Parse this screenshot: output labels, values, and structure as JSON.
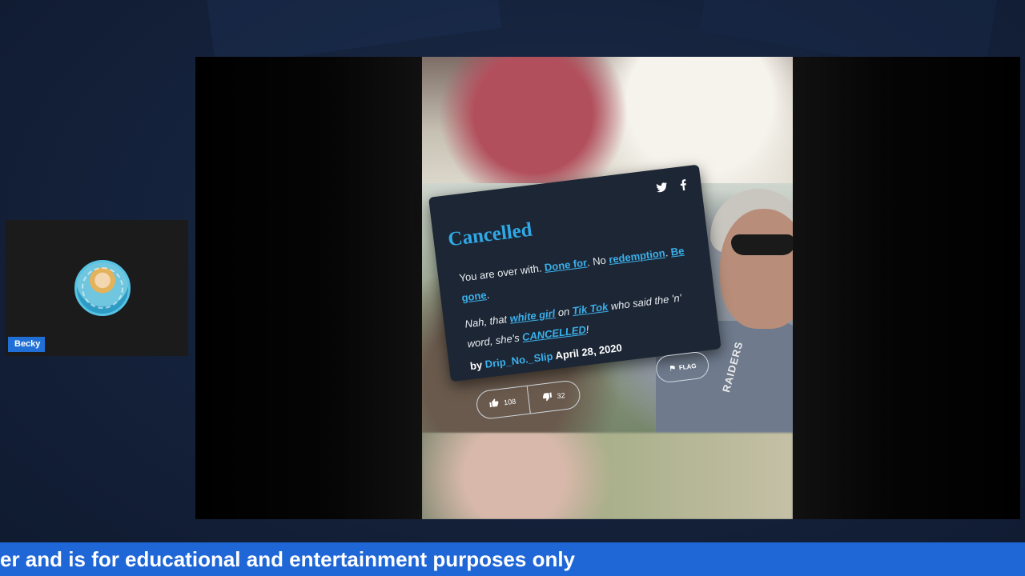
{
  "participant": {
    "name": "Becky"
  },
  "card": {
    "title": "Cancelled",
    "definition": {
      "t1": "You are over with. ",
      "l1": "Done for",
      "t2": ". No ",
      "l2": "redemption",
      "t3": ". ",
      "l3": "Be gone",
      "t4": "."
    },
    "example": {
      "t1": "Nah, that ",
      "l1": "white girl",
      "t2": " on ",
      "l2": "Tik Tok",
      "t3": " who said the 'n' word, she's ",
      "l3": "CANCELLED",
      "t4": "!"
    },
    "author_prefix": "by ",
    "author": "Drip_No._Slip",
    "date": "April 28, 2020",
    "upvotes": "108",
    "downvotes": "32",
    "flag_label": "FLAG"
  },
  "video": {
    "lanyard_text": "RAIDERS"
  },
  "ticker": {
    "text": "er and is for educational and entertainment purposes only"
  },
  "icons": [
    "twitter-icon",
    "facebook-icon",
    "thumbs-up-icon",
    "thumbs-down-icon",
    "flag-icon"
  ],
  "colors": {
    "ticker_bg": "#1f66d6",
    "link": "#3ab0ec",
    "title": "#2fa8e6",
    "card_bg": "#1d2634",
    "name_tag": "#1f6fd6"
  }
}
